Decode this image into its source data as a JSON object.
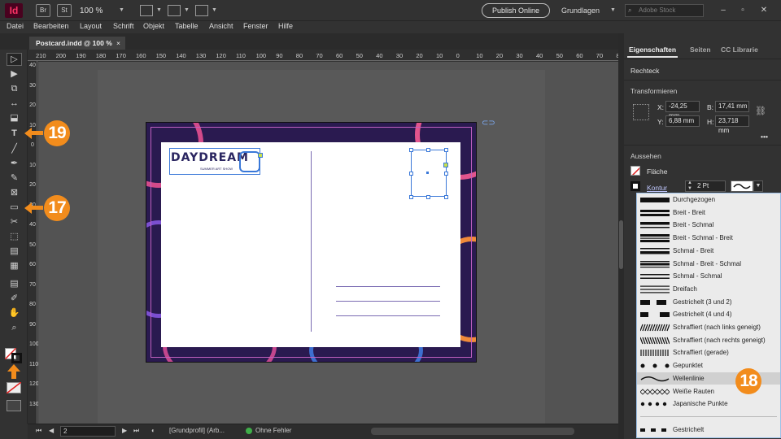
{
  "app": {
    "logo": "Id",
    "bridge": "Br",
    "stock_app": "St",
    "zoom": "100 %",
    "publish": "Publish Online",
    "workspace": "Grundlagen",
    "search_placeholder": "Adobe Stock"
  },
  "menu": [
    "Datei",
    "Bearbeiten",
    "Layout",
    "Schrift",
    "Objekt",
    "Tabelle",
    "Ansicht",
    "Fenster",
    "Hilfe"
  ],
  "document_tab": {
    "title": "Postcard.indd @ 100 %",
    "close": "×"
  },
  "ruler": {
    "horizontal": [
      "210",
      "200",
      "190",
      "180",
      "170",
      "160",
      "150",
      "140",
      "130",
      "120",
      "110",
      "100",
      "90",
      "80",
      "70",
      "60",
      "50",
      "40",
      "30",
      "20",
      "10",
      "0",
      "10",
      "20",
      "30",
      "40",
      "50",
      "60",
      "70",
      "80",
      "90"
    ],
    "vertical": [
      "40",
      "30",
      "20",
      "10",
      "0",
      "10",
      "20",
      "30",
      "40",
      "50",
      "60",
      "70",
      "80",
      "90",
      "100",
      "110",
      "120",
      "130"
    ]
  },
  "artwork": {
    "logo_title": "DAYDREAM",
    "logo_subtitle": "SUMMER ART SHOW"
  },
  "callouts": {
    "type_tool": "19",
    "rectangle_tool": "17",
    "stroke_type": "18"
  },
  "status": {
    "page": "2",
    "profile": "[Grundprofil] (Arb...",
    "errors": "Ohne Fehler"
  },
  "properties": {
    "tabs": [
      "Eigenschaften",
      "Seiten",
      "CC Librarie"
    ],
    "object_type": "Rechteck",
    "transform_heading": "Transformieren",
    "x_label": "X:",
    "x_value": "-24,25 mm",
    "y_label": "Y:",
    "y_value": "6,88 mm",
    "b_label": "B:",
    "b_value": "17,41 mm",
    "h_label": "H:",
    "h_value": "23,718 mm",
    "more": "•••",
    "appearance_heading": "Aussehen",
    "fill_label": "Fläche",
    "stroke_label": "Kontur",
    "stroke_weight": "2 Pt"
  },
  "stroke_types": [
    "Durchgezogen",
    "Breit - Breit",
    "Breit - Schmal",
    "Breit - Schmal - Breit",
    "Schmal - Breit",
    "Schmal - Breit - Schmal",
    "Schmal - Schmal",
    "Dreifach",
    "Gestrichelt (3 und 2)",
    "Gestrichelt (4 und 4)",
    "Schraffiert (nach links geneigt)",
    "Schraffiert (nach rechts geneigt)",
    "Schraffiert (gerade)",
    "Gepunktet",
    "Wellenlinie",
    "Weiße Rauten",
    "Japanische Punkte",
    "",
    "Gestrichelt"
  ],
  "selected_stroke_type": "Wellenlinie",
  "colors": {
    "accent_orange": "#f28c1c",
    "selection_blue": "#3a78d8",
    "card_purple": "#2a1a50"
  }
}
